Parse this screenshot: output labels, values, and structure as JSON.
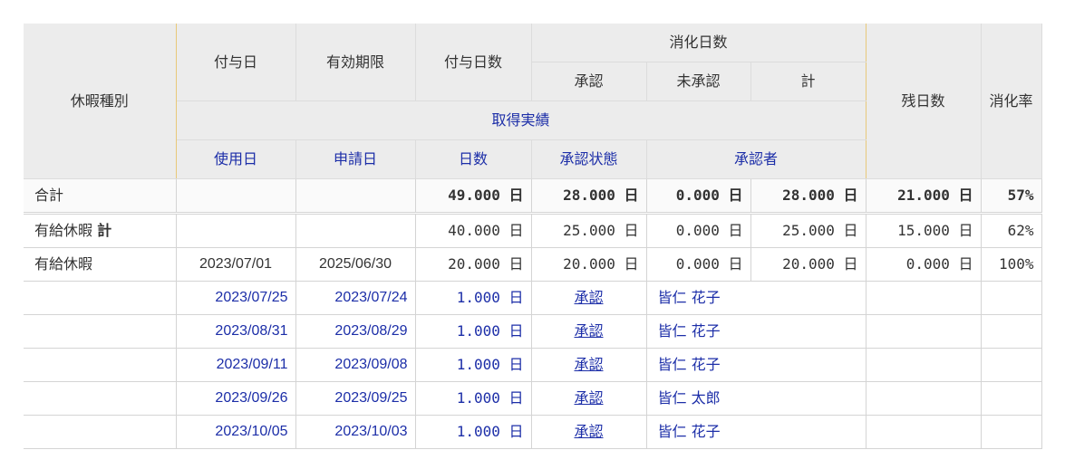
{
  "header": {
    "kind": "休暇種別",
    "grant_date": "付与日",
    "expiry": "有効期限",
    "grant_days": "付与日数",
    "consumed": "消化日数",
    "approved": "承認",
    "unapproved": "未承認",
    "total": "計",
    "remaining": "残日数",
    "rate": "消化率",
    "record": "取得実績",
    "use_date": "使用日",
    "apply_date": "申請日",
    "days": "日数",
    "status": "承認状態",
    "approver": "承認者"
  },
  "total_row": {
    "label": "合計",
    "grant_days": "49.000 日",
    "approved": "28.000 日",
    "unapproved": "0.000 日",
    "total": "28.000 日",
    "remaining": "21.000 日",
    "rate": "57%"
  },
  "paid_total_row": {
    "label": "有給休暇",
    "label_suffix": "計",
    "grant_days": "40.000 日",
    "approved": "25.000 日",
    "unapproved": "0.000 日",
    "total": "25.000 日",
    "remaining": "15.000 日",
    "rate": "62%"
  },
  "paid_row": {
    "label": "有給休暇",
    "grant_date": "2023/07/01",
    "expiry": "2025/06/30",
    "grant_days": "20.000 日",
    "approved": "20.000 日",
    "unapproved": "0.000 日",
    "total": "20.000 日",
    "remaining": "0.000 日",
    "rate": "100%"
  },
  "records": [
    {
      "use_date": "2023/07/25",
      "apply_date": "2023/07/24",
      "days": "1.000 日",
      "status": "承認",
      "approver": "皆仁 花子"
    },
    {
      "use_date": "2023/08/31",
      "apply_date": "2023/08/29",
      "days": "1.000 日",
      "status": "承認",
      "approver": "皆仁 花子"
    },
    {
      "use_date": "2023/09/11",
      "apply_date": "2023/09/08",
      "days": "1.000 日",
      "status": "承認",
      "approver": "皆仁 花子"
    },
    {
      "use_date": "2023/09/26",
      "apply_date": "2023/09/25",
      "days": "1.000 日",
      "status": "承認",
      "approver": "皆仁 太郎"
    },
    {
      "use_date": "2023/10/05",
      "apply_date": "2023/10/03",
      "days": "1.000 日",
      "status": "承認",
      "approver": "皆仁 花子"
    }
  ],
  "colors": {
    "header_bg": "#ececec",
    "link": "#1c2ea8",
    "gold_border": "#e8c879"
  }
}
